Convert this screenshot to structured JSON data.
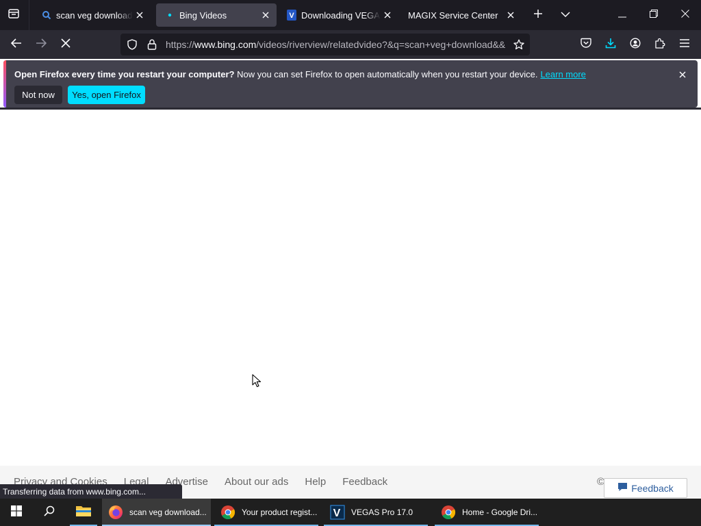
{
  "tabs": [
    {
      "title": "scan veg download - S",
      "active": false,
      "favicon": "bing-search-icon"
    },
    {
      "title": "Bing Videos",
      "active": true,
      "favicon": "loading-dot-icon"
    },
    {
      "title": "Downloading VEGAS Pr",
      "active": false,
      "favicon": "vegas-icon"
    },
    {
      "title": "MAGIX Service Center",
      "active": false,
      "favicon": "none"
    }
  ],
  "nav": {
    "url_prefix": "https://",
    "url_host": "www.bing.com",
    "url_rest": "/videos/riverview/relatedvideo?&q=scan+veg+download&&"
  },
  "notice": {
    "bold": "Open Firefox every time you restart your computer?",
    "text": "Now you can set Firefox to open automatically when you restart your device.",
    "link": "Learn more",
    "btn_no": "Not now",
    "btn_yes": "Yes, open Firefox"
  },
  "footer": {
    "links": [
      "Privacy and Cookies",
      "Legal",
      "Advertise",
      "About our ads",
      "Help",
      "Feedback"
    ],
    "copyright": "©",
    "feedback_button": "Feedback"
  },
  "status_text": "Transferring data from www.bing.com...",
  "taskbar": {
    "apps": [
      {
        "label": "scan veg download...",
        "icon": "firefox-icon",
        "active": true
      },
      {
        "label": "Your product regist...",
        "icon": "chrome-icon",
        "active": false
      },
      {
        "label": "VEGAS Pro 17.0",
        "icon": "vegas-icon",
        "active": false
      },
      {
        "label": "Home - Google Dri...",
        "icon": "chrome-icon",
        "active": false
      }
    ]
  },
  "colors": {
    "tabstrip": "#1c1b22",
    "navbar": "#2b2a33",
    "accent": "#00ddff",
    "taskbar": "#1f1f1f"
  }
}
